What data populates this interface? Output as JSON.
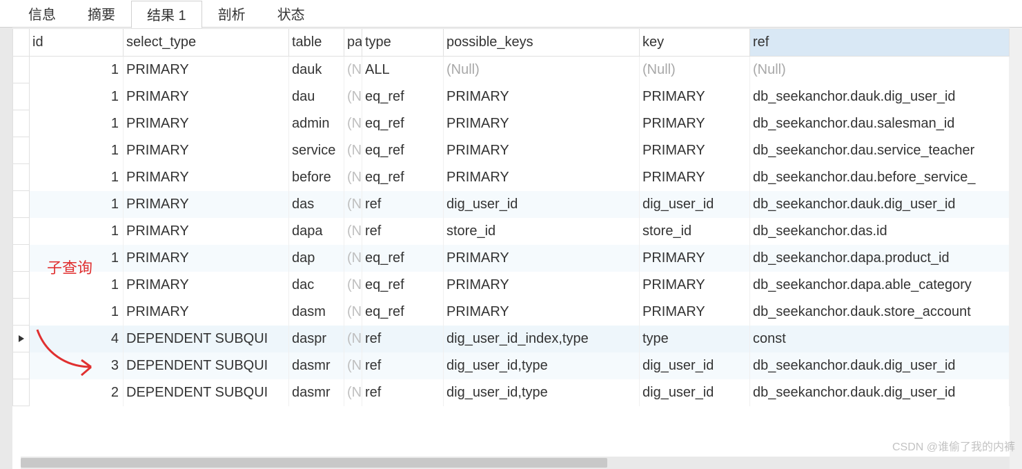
{
  "tabs": [
    {
      "label": "信息",
      "active": false
    },
    {
      "label": "摘要",
      "active": false
    },
    {
      "label": "结果 1",
      "active": true
    },
    {
      "label": "剖析",
      "active": false
    },
    {
      "label": "状态",
      "active": false
    }
  ],
  "columns": {
    "rowhead": "",
    "id": "id",
    "select_type": "select_type",
    "table": "table",
    "partitions": "pa",
    "type": "type",
    "possible_keys": "possible_keys",
    "key": "key",
    "ref": "ref"
  },
  "partitions_prefix": "(N",
  "null_text": "(Null)",
  "annotation": "子查询",
  "watermark": "CSDN @谁偷了我的内裤",
  "rows": [
    {
      "id": "1",
      "select_type": "PRIMARY",
      "table": "dauk",
      "type": "ALL",
      "possible_keys": null,
      "key": null,
      "ref": null,
      "alt": false,
      "current": false
    },
    {
      "id": "1",
      "select_type": "PRIMARY",
      "table": "dau",
      "type": "eq_ref",
      "possible_keys": "PRIMARY",
      "key": "PRIMARY",
      "ref": "db_seekanchor.dauk.dig_user_id",
      "alt": false,
      "current": false
    },
    {
      "id": "1",
      "select_type": "PRIMARY",
      "table": "admin",
      "type": "eq_ref",
      "possible_keys": "PRIMARY",
      "key": "PRIMARY",
      "ref": "db_seekanchor.dau.salesman_id",
      "alt": false,
      "current": false
    },
    {
      "id": "1",
      "select_type": "PRIMARY",
      "table": "service",
      "type": "eq_ref",
      "possible_keys": "PRIMARY",
      "key": "PRIMARY",
      "ref": "db_seekanchor.dau.service_teacher",
      "alt": false,
      "current": false
    },
    {
      "id": "1",
      "select_type": "PRIMARY",
      "table": "before",
      "type": "eq_ref",
      "possible_keys": "PRIMARY",
      "key": "PRIMARY",
      "ref": "db_seekanchor.dau.before_service_",
      "alt": false,
      "current": false
    },
    {
      "id": "1",
      "select_type": "PRIMARY",
      "table": "das",
      "type": "ref",
      "possible_keys": "dig_user_id",
      "key": "dig_user_id",
      "ref": "db_seekanchor.dauk.dig_user_id",
      "alt": true,
      "current": false
    },
    {
      "id": "1",
      "select_type": "PRIMARY",
      "table": "dapa",
      "type": "ref",
      "possible_keys": "store_id",
      "key": "store_id",
      "ref": "db_seekanchor.das.id",
      "alt": false,
      "current": false
    },
    {
      "id": "1",
      "select_type": "PRIMARY",
      "table": "dap",
      "type": "eq_ref",
      "possible_keys": "PRIMARY",
      "key": "PRIMARY",
      "ref": "db_seekanchor.dapa.product_id",
      "alt": true,
      "current": false
    },
    {
      "id": "1",
      "select_type": "PRIMARY",
      "table": "dac",
      "type": "eq_ref",
      "possible_keys": "PRIMARY",
      "key": "PRIMARY",
      "ref": "db_seekanchor.dapa.able_category",
      "alt": false,
      "current": false
    },
    {
      "id": "1",
      "select_type": "PRIMARY",
      "table": "dasm",
      "type": "eq_ref",
      "possible_keys": "PRIMARY",
      "key": "PRIMARY",
      "ref": "db_seekanchor.dauk.store_account",
      "alt": false,
      "current": false
    },
    {
      "id": "4",
      "select_type": "DEPENDENT SUBQUI",
      "table": "daspr",
      "type": "ref",
      "possible_keys": "dig_user_id_index,type",
      "key": "type",
      "ref": "const",
      "alt": false,
      "current": true
    },
    {
      "id": "3",
      "select_type": "DEPENDENT SUBQUI",
      "table": "dasmr",
      "type": "ref",
      "possible_keys": "dig_user_id,type",
      "key": "dig_user_id",
      "ref": "db_seekanchor.dauk.dig_user_id",
      "alt": true,
      "current": false
    },
    {
      "id": "2",
      "select_type": "DEPENDENT SUBQUI",
      "table": "dasmr",
      "type": "ref",
      "possible_keys": "dig_user_id,type",
      "key": "dig_user_id",
      "ref": "db_seekanchor.dauk.dig_user_id",
      "alt": false,
      "current": false
    }
  ]
}
